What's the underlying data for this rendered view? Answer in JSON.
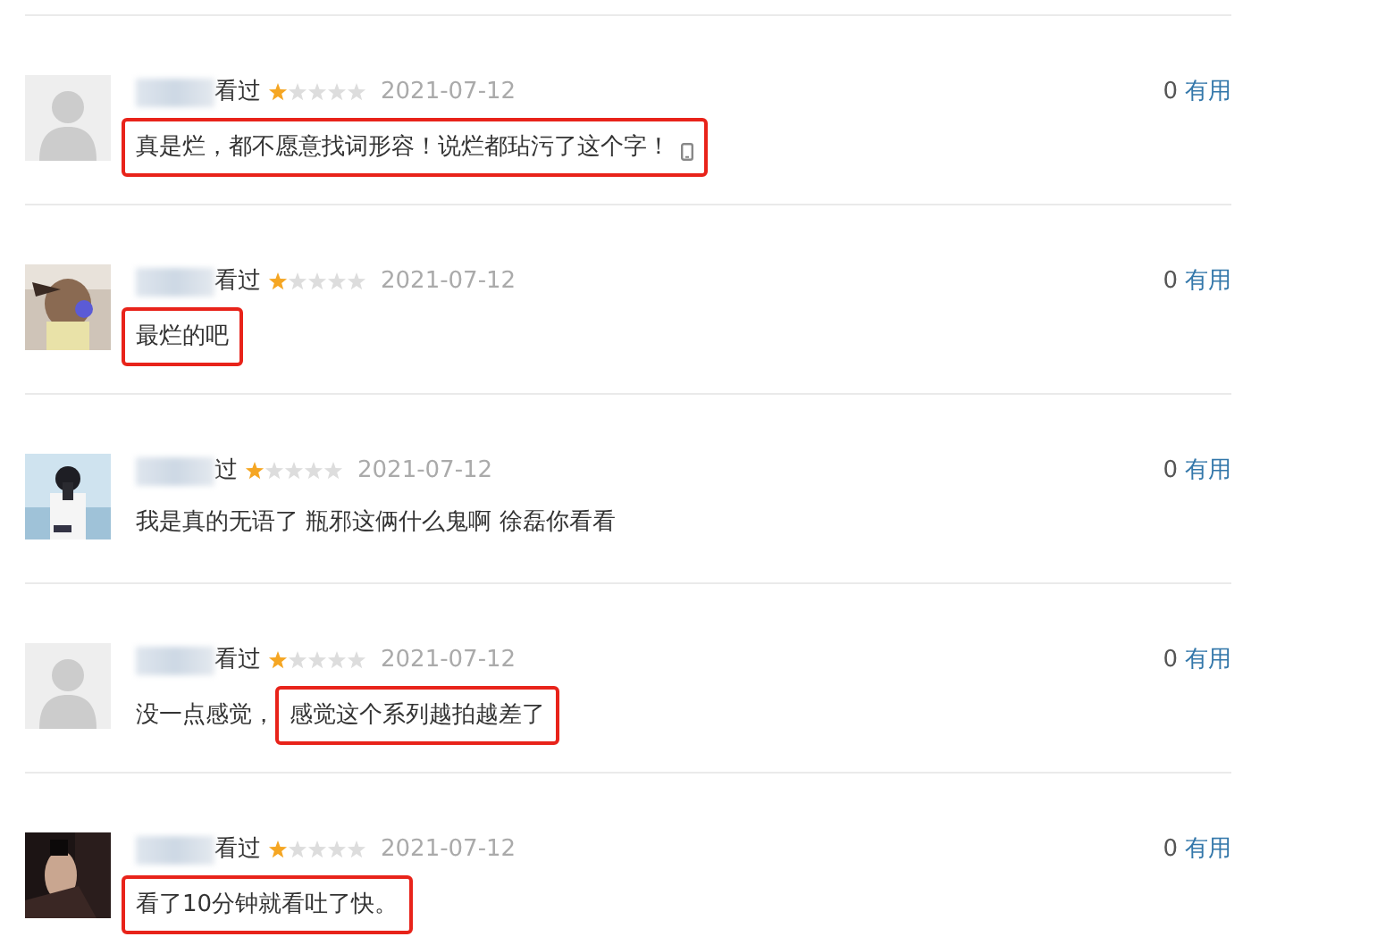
{
  "comments": [
    {
      "avatar": {
        "kind": "default"
      },
      "watched": "看过",
      "stars": 1,
      "date": "2021-07-12",
      "useful_count": "0",
      "useful_label": "有用",
      "mobile": true,
      "segments": [
        {
          "text": "真是烂，都不愿意找词形容！说烂都玷污了这个字！",
          "boxed": true
        }
      ]
    },
    {
      "avatar": {
        "kind": "picture"
      },
      "watched": "看过",
      "stars": 1,
      "date": "2021-07-12",
      "useful_count": "0",
      "useful_label": "有用",
      "mobile": false,
      "segments": [
        {
          "text": "最烂的吧",
          "boxed": true
        }
      ]
    },
    {
      "avatar": {
        "kind": "picture"
      },
      "watched": "过",
      "stars": 1,
      "date": "2021-07-12",
      "useful_count": "0",
      "useful_label": "有用",
      "mobile": false,
      "segments": [
        {
          "text": "我是真的无语了 瓶邪这俩什么鬼啊 徐磊你看看",
          "boxed": false
        }
      ]
    },
    {
      "avatar": {
        "kind": "default"
      },
      "watched": "看过",
      "stars": 1,
      "date": "2021-07-12",
      "useful_count": "0",
      "useful_label": "有用",
      "mobile": false,
      "segments": [
        {
          "text": "没一点感觉，",
          "boxed": false
        },
        {
          "text": "感觉这个系列越拍越差了",
          "boxed": true
        }
      ]
    },
    {
      "avatar": {
        "kind": "picture"
      },
      "watched": "看过",
      "stars": 1,
      "date": "2021-07-12",
      "useful_count": "0",
      "useful_label": "有用",
      "mobile": false,
      "segments": [
        {
          "text": "看了10分钟就看吐了快。",
          "boxed": true
        }
      ]
    }
  ]
}
